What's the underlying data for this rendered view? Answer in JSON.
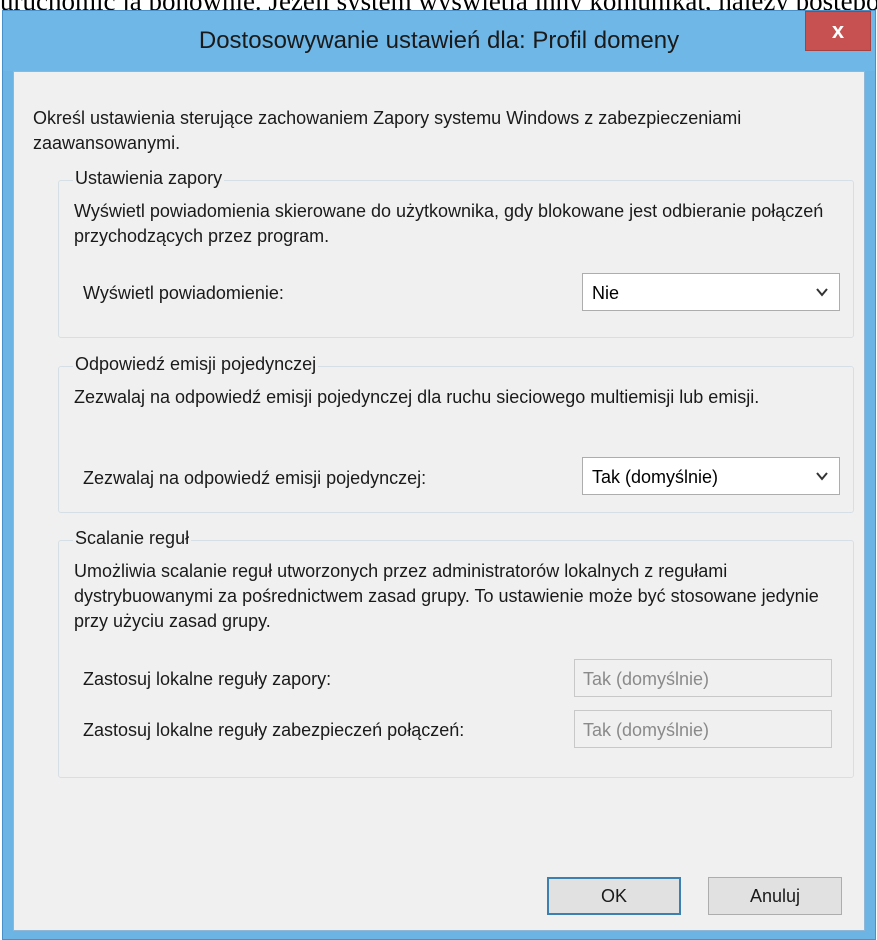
{
  "background_text": "uruchomić ją ponownie. Jeżeli system wyświetla inny komunikat, należy postępować",
  "dialog": {
    "title": "Dostosowywanie ustawień dla: Profil domeny",
    "close_label": "x",
    "intro": "Określ ustawienia sterujące zachowaniem Zapory systemu Windows z zabezpieczeniami zaawansowanymi."
  },
  "firewall_settings": {
    "group_label": "Ustawienia zapory",
    "description": "Wyświetl powiadomienia skierowane do użytkownika, gdy blokowane jest odbieranie połączeń przychodzących przez program.",
    "notification_label": "Wyświetl powiadomienie:",
    "notification_value": "Nie"
  },
  "unicast_response": {
    "group_label": "Odpowiedź emisji pojedynczej",
    "description": "Zezwalaj na odpowiedź emisji pojedynczej dla ruchu sieciowego multiemisji lub emisji.",
    "allow_label": "Zezwalaj na odpowiedź emisji pojedynczej:",
    "allow_value": "Tak (domyślnie)"
  },
  "rule_merging": {
    "group_label": "Scalanie reguł",
    "description": "Umożliwia scalanie reguł utworzonych przez administratorów lokalnych z regułami dystrybuowanymi za pośrednictwem zasad grupy. To ustawienie może być stosowane jedynie przy użyciu zasad grupy.",
    "local_firewall_label": "Zastosuj lokalne reguły zapory:",
    "local_firewall_value": "Tak (domyślnie)",
    "local_security_label": "Zastosuj lokalne reguły zabezpieczeń połączeń:",
    "local_security_value": "Tak (domyślnie)"
  },
  "buttons": {
    "ok": "OK",
    "cancel": "Anuluj"
  },
  "colors": {
    "titlebar": "#6fb7e7",
    "close_button": "#c75050",
    "client_bg": "#f0f0f0"
  }
}
